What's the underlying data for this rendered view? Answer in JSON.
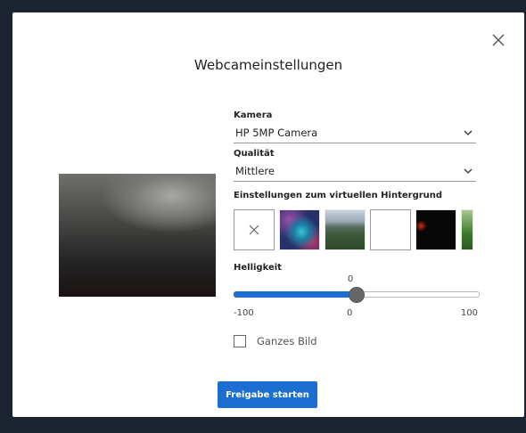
{
  "dialog": {
    "title": "Webcameinstellungen",
    "close_icon": "close-icon"
  },
  "camera": {
    "label": "Kamera",
    "selected": "HP 5MP Camera"
  },
  "quality": {
    "label": "Qualität",
    "selected": "Mittlere"
  },
  "background": {
    "label": "Einstellungen zum virtuellen Hintergrund",
    "options": [
      "none",
      "aurora",
      "landscape",
      "white",
      "dark-space",
      "green-field"
    ]
  },
  "brightness": {
    "label": "Helligkeit",
    "value": "0",
    "min_label": "-100",
    "mid_label": "0",
    "max_label": "100",
    "fraction": 0.5
  },
  "full_image": {
    "label": "Ganzes Bild",
    "checked": false
  },
  "actions": {
    "start_label": "Freigabe starten"
  },
  "colors": {
    "accent": "#1c6fd1",
    "backdrop": "#1b2430"
  }
}
